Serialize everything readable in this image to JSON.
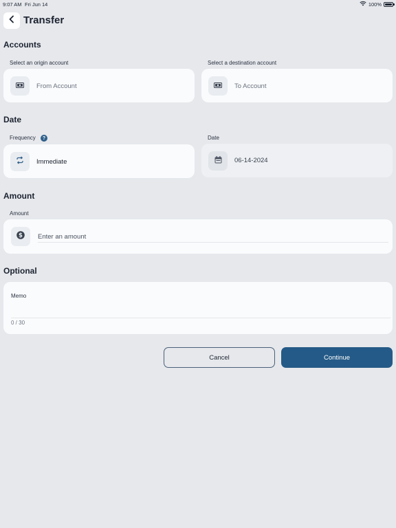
{
  "status_bar": {
    "time": "9:07 AM",
    "date": "Fri Jun 14",
    "battery": "100%"
  },
  "header": {
    "title": "Transfer"
  },
  "accounts": {
    "section_title": "Accounts",
    "origin_label": "Select an origin account",
    "origin_value": "From Account",
    "destination_label": "Select a destination account",
    "destination_value": "To Account"
  },
  "date_section": {
    "section_title": "Date",
    "frequency_label": "Frequency",
    "help_glyph": "?",
    "frequency_value": "Immediate",
    "date_label": "Date",
    "date_value": "06-14-2024"
  },
  "amount": {
    "section_title": "Amount",
    "label": "Amount",
    "placeholder": "Enter an amount"
  },
  "optional": {
    "section_title": "Optional",
    "memo_label": "Memo",
    "memo_counter": "0 / 30"
  },
  "actions": {
    "cancel_label": "Cancel",
    "continue_label": "Continue"
  },
  "colors": {
    "background": "#e6e8ec",
    "primary": "#245a87",
    "help_icon": "#2f5f8a",
    "card": "#f7f8fa"
  },
  "icons": {
    "back": "chevron-left-icon",
    "origin": "money-bill-icon",
    "destination": "money-bill-icon",
    "frequency": "repeat-icon",
    "date": "calendar-icon",
    "amount": "dollar-circle-icon",
    "help": "question-circle-icon",
    "wifi": "wifi-icon",
    "battery": "battery-icon"
  }
}
